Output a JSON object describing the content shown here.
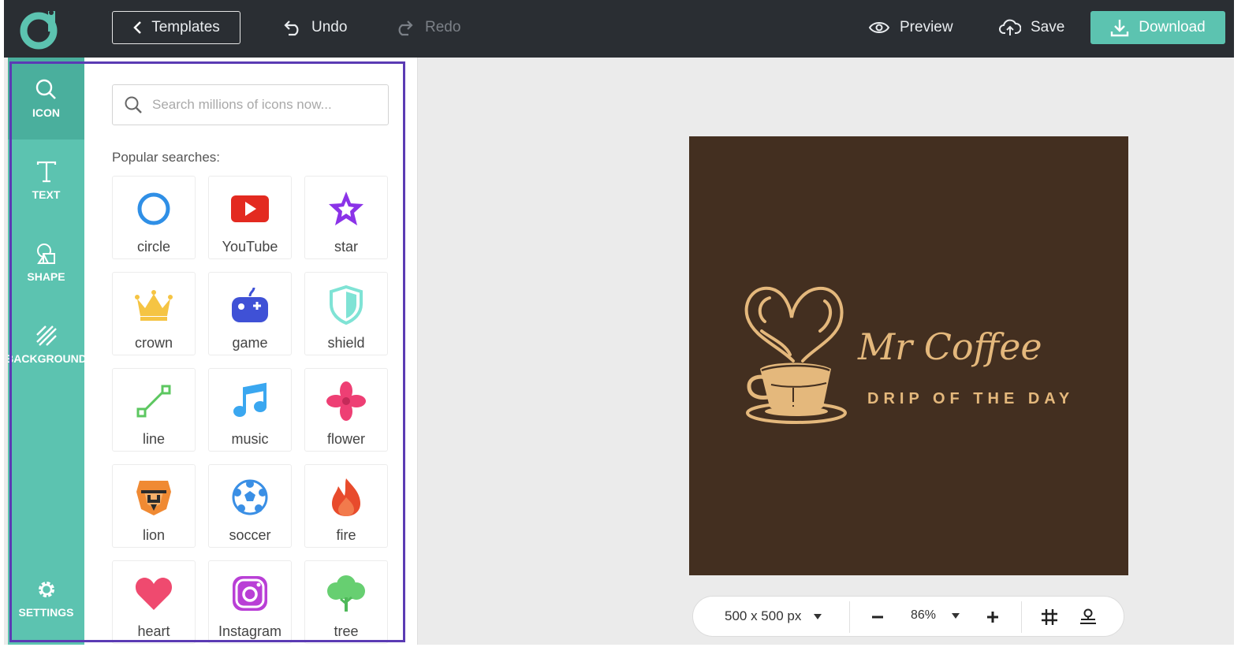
{
  "topbar": {
    "templates_label": "Templates",
    "undo_label": "Undo",
    "redo_label": "Redo",
    "preview_label": "Preview",
    "save_label": "Save",
    "download_label": "Download"
  },
  "colors": {
    "accent": "#5cc3b0",
    "topbar": "#2a2e33",
    "canvas_bg": "#432f20",
    "brand_gold": "#e4b87c",
    "highlight": "#5b3bb4"
  },
  "sidebar": {
    "items": [
      {
        "label": "ICON",
        "icon": "search-icon",
        "active": true
      },
      {
        "label": "TEXT",
        "icon": "text-icon",
        "active": false
      },
      {
        "label": "SHAPE",
        "icon": "shape-icon",
        "active": false
      },
      {
        "label": "BACKGROUND",
        "icon": "background-icon",
        "active": false
      },
      {
        "label": "SETTINGS",
        "icon": "gear-icon",
        "active": false
      }
    ]
  },
  "panel": {
    "search_placeholder": "Search millions of icons now...",
    "popular_label": "Popular searches:",
    "icons": [
      {
        "label": "circle",
        "icon": "circle-icon"
      },
      {
        "label": "YouTube",
        "icon": "youtube-icon"
      },
      {
        "label": "star",
        "icon": "star-icon"
      },
      {
        "label": "crown",
        "icon": "crown-icon"
      },
      {
        "label": "game",
        "icon": "gamepad-icon"
      },
      {
        "label": "shield",
        "icon": "shield-icon"
      },
      {
        "label": "line",
        "icon": "line-icon"
      },
      {
        "label": "music",
        "icon": "music-icon"
      },
      {
        "label": "flower",
        "icon": "flower-icon"
      },
      {
        "label": "lion",
        "icon": "lion-icon"
      },
      {
        "label": "soccer",
        "icon": "soccer-ball-icon"
      },
      {
        "label": "fire",
        "icon": "fire-icon"
      },
      {
        "label": "heart",
        "icon": "heart-icon"
      },
      {
        "label": "Instagram",
        "icon": "instagram-icon"
      },
      {
        "label": "tree",
        "icon": "tree-icon"
      }
    ]
  },
  "canvas": {
    "brand_name": "Mr Coffee",
    "tagline": "DRIP OF THE DAY"
  },
  "bottombar": {
    "size_label": "500 x 500 px",
    "zoom_label": "86%"
  }
}
